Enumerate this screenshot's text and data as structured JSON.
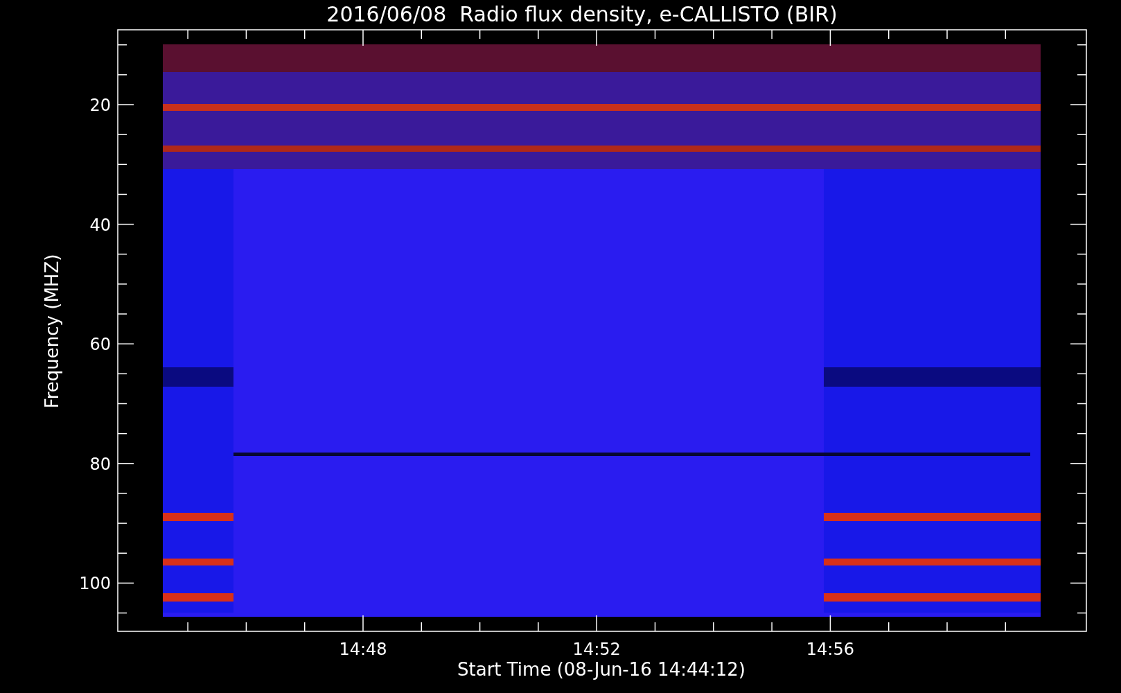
{
  "title": "2016/06/08  Radio flux density, e-CALLISTO (BIR)",
  "x_axis": {
    "label": "Start Time (08-Jun-16 14:44:12)",
    "ticks": [
      "14:48",
      "14:52",
      "14:56"
    ]
  },
  "y_axis": {
    "label": "Frequency (MHZ)",
    "ticks": [
      "20",
      "40",
      "60",
      "80",
      "100"
    ]
  }
}
